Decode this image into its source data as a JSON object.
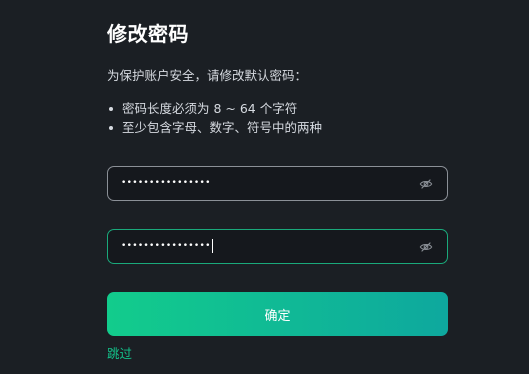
{
  "title": "修改密码",
  "intro": "为保护账户安全，请修改默认密码：",
  "rules": [
    "密码长度必须为 8 ~ 64 个字符",
    "至少包含字母、数字、符号中的两种"
  ],
  "fields": [
    {
      "masked_value": "••••••••••••••••",
      "icon": "eye-off-icon"
    },
    {
      "masked_value": "••••••••••••••••",
      "icon": "eye-off-icon"
    }
  ],
  "confirm_label": "确定",
  "skip_label": "跳过",
  "colors": {
    "background": "#1b1f24",
    "accent": "#13c28a",
    "button_gradient_start": "#12cc8c",
    "button_gradient_end": "#0ea89e",
    "field_border": "#8b9097",
    "field_border_focused": "#1aa97b"
  }
}
